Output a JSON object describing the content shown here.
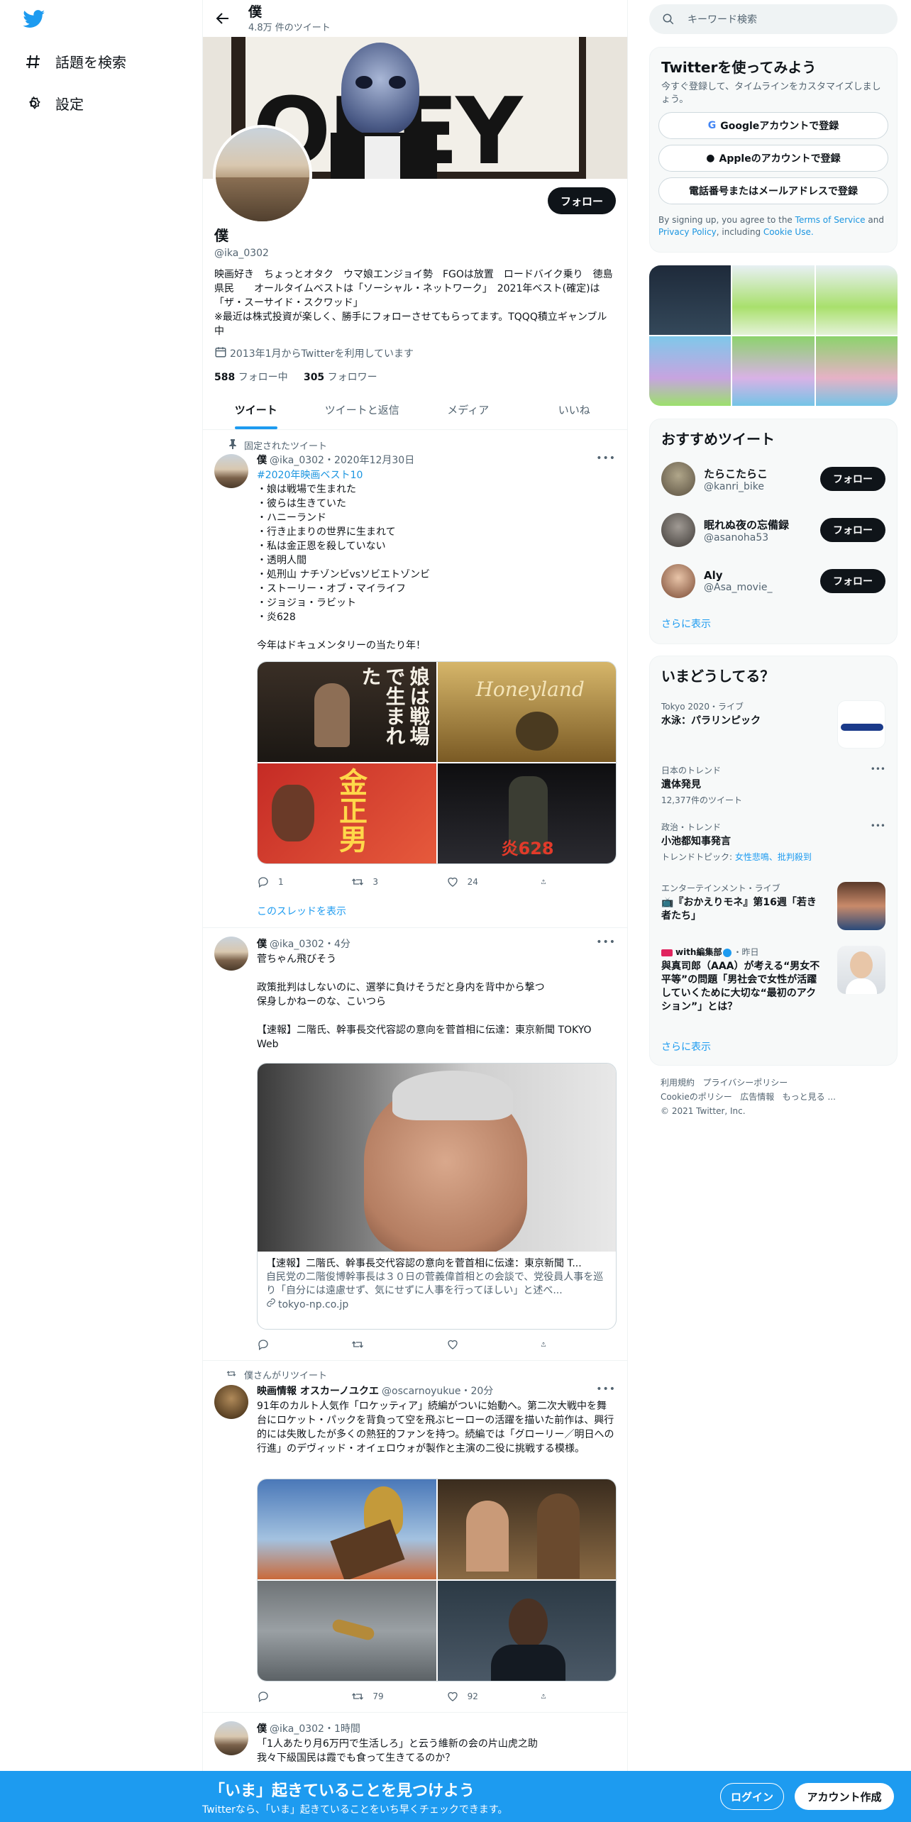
{
  "nav": {
    "explore_label": "話題を検索",
    "settings_label": "設定"
  },
  "header": {
    "name": "僕",
    "tweet_count": "4.8万 件のツイート"
  },
  "profile": {
    "name": "僕",
    "handle": "@ika_0302",
    "follow_label": "フォロー",
    "bio": "映画好き　ちょっとオタク　ウマ娘エンジョイ勢　FGOは放置　ロードバイク乗り　徳島県民　　オールタイムベストは「ソーシャル・ネットワーク」　2021年ベスト(確定)は「ザ・スーサイド・スクワッド」\n※最近は株式投資が楽しく、勝手にフォローさせてもらってます。TQQQ積立ギャンブル中",
    "joined": "2013年1月からTwitterを利用しています",
    "following_count": "588",
    "following_label": "フォロー中",
    "followers_count": "305",
    "followers_label": "フォロワー",
    "banner_text": "OBEY"
  },
  "tabs": [
    "ツイート",
    "ツイートと返信",
    "メディア",
    "いいね"
  ],
  "tweets": [
    {
      "context": "固定されたツイート",
      "name": "僕",
      "meta": "@ika_0302・2020年12月30日",
      "hashtag": "#2020年映画ベスト10",
      "text": "・娘は戦場で生まれた\n・彼らは生きていた\n・ハニーランド\n・行き止まりの世界に生まれて\n・私は金正恩を殺していない\n・透明人間\n・処刑山 ナチゾンビvsソビエトゾンビ\n・ストーリー・オブ・マイライフ\n・ジョジョ・ラビット\n・炎628\n\n今年はドキュメンタリーの当たり年！",
      "replies": "1",
      "retweets": "3",
      "likes": "24",
      "thread_link": "このスレッドを表示",
      "poster_texts": [
        "娘は戦場で生まれた",
        "Honeyland",
        "金正男",
        "炎628"
      ]
    },
    {
      "name": "僕",
      "meta": "@ika_0302・4分",
      "text": "菅ちゃん飛びそう\n\n政策批判はしないのに、選挙に負けそうだと身内を背中から撃つ\n保身しかねーのな、こいつら\n\n【速報】二階氏、幹事長交代容認の意向を菅首相に伝達：東京新聞 TOKYO Web",
      "card_title": "【速報】二階氏、幹事長交代容認の意向を菅首相に伝達：東京新聞 T...",
      "card_desc": "自民党の二階俊博幹事長は３０日の菅義偉首相との会談で、党役員人事を巡り「自分には遠慮せず、気にせずに人事を行ってほしい」と述べ...",
      "card_domain": "tokyo-np.co.jp",
      "replies": "",
      "retweets": "",
      "likes": ""
    },
    {
      "context": "僕さんがリツイート",
      "name": "映画情報 オスカーノユクエ",
      "meta": "@oscarnoyukue・20分",
      "text": "91年のカルト人気作「ロケッティア」続編がついに始動へ。第二次大戦中を舞台にロケット・パックを背負って空を飛ぶヒーローの活躍を描いた前作は、興行的には失敗したが多くの熱狂的ファンを持つ。続編では「グローリー／明日への行進」のデヴィッド・オイェロウォが製作と主演の二役に挑戦する模様。",
      "replies": "",
      "retweets": "79",
      "likes": "92"
    },
    {
      "name": "僕",
      "meta": "@ika_0302・1時間",
      "text": "「1人あたり月6万円で生活しろ」と云う維新の会の片山虎之助\n我々下級国民は霞でも食って生きてるのか？"
    }
  ],
  "sidebar": {
    "search_placeholder": "キーワード検索",
    "signup": {
      "title": "Twitterを使ってみよう",
      "subtitle": "今すぐ登録して、タイムラインをカスタマイズしましょう。",
      "google": "Googleアカウントで登録",
      "apple": "Appleのアカウントで登録",
      "phone": "電話番号またはメールアドレスで登録",
      "terms_prefix": "By signing up, you agree to the",
      "terms": "Terms of Service",
      "and": "and",
      "privacy": "Privacy Policy",
      "including": ", including",
      "cookie": "Cookie Use."
    },
    "recommended": {
      "title": "おすすめツイート",
      "users": [
        {
          "name": "たらこたらこ",
          "handle": "@kanri_bike"
        },
        {
          "name": "眠れぬ夜の忘備録",
          "handle": "@asanoha53"
        },
        {
          "name": "Aly",
          "handle": "@Asa_movie_"
        }
      ],
      "follow": "フォロー",
      "more": "さらに表示"
    },
    "trends": {
      "title": "いまどうしてる？",
      "items": [
        {
          "cat": "Tokyo 2020・ライブ",
          "title": "水泳：パラリンピック",
          "sub": ""
        },
        {
          "cat": "日本のトレンド",
          "title": "遺体発見",
          "sub": "12,377件のツイート"
        },
        {
          "cat": "政治・トレンド",
          "title": "小池都知事発言",
          "sub_prefix": "トレンドトピック: ",
          "sub_links": "女性悲鳴、批判殺到"
        },
        {
          "cat": "エンターテインメント・ライブ",
          "title": "📺『おかえりモネ』第16週「若き者たち」",
          "sub": ""
        },
        {
          "cat_name": "with編集部",
          "cat_time": "・昨日",
          "title": "與真司郎（AAA）が考える“男女不平等”の問題「男社会で女性が活躍していくために大切な“最初のアクション”」とは？",
          "sub": ""
        }
      ],
      "more": "さらに表示"
    },
    "footer": {
      "links": [
        "利用規約",
        "プライバシーポリシー",
        "Cookieのポリシー",
        "広告情報",
        "もっと見る ..."
      ],
      "copyright": "© 2021 Twitter, Inc."
    }
  },
  "bottom_bar": {
    "title": "「いま」起きていることを見つけよう",
    "subtitle": "Twitterなら、「いま」起きていることをいち早くチェックできます。",
    "login": "ログイン",
    "signup": "アカウント作成"
  },
  "colors": {
    "accent": "#1d9bf0",
    "text": "#0f1419",
    "muted": "#536471"
  }
}
